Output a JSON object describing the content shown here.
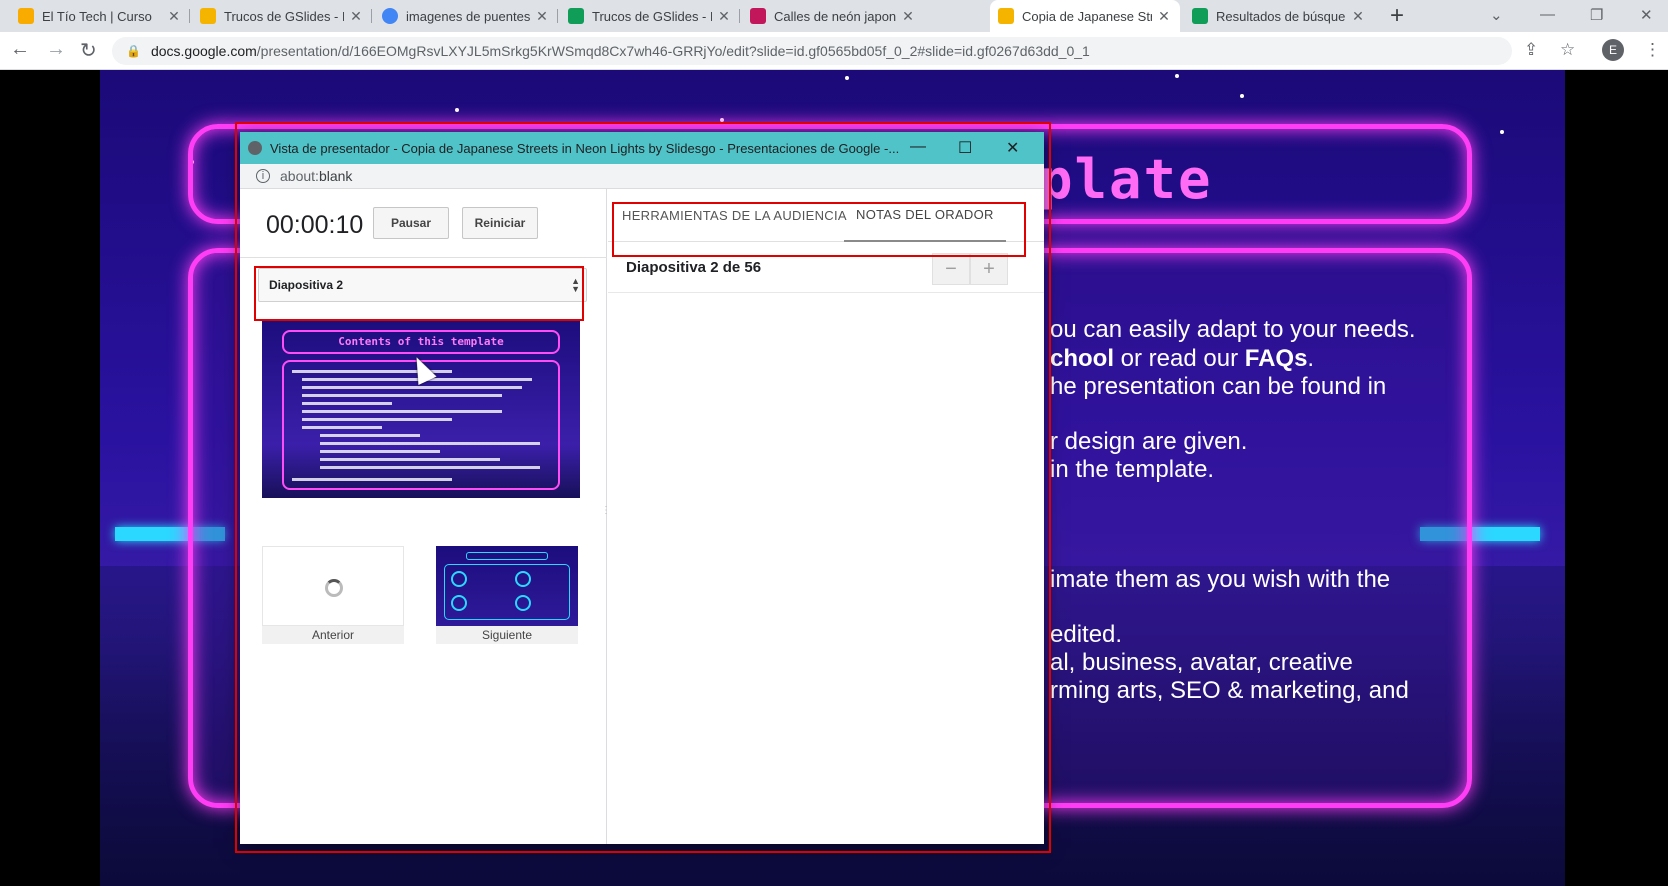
{
  "browser": {
    "tabs": [
      {
        "label": "El Tío Tech | Curso",
        "fav": "#f9ab00"
      },
      {
        "label": "Trucos de GSlides - Pr",
        "fav": "#f4b400"
      },
      {
        "label": "imagenes de puentes",
        "fav": "#4285f4"
      },
      {
        "label": "Trucos de GSlides - H",
        "fav": "#0f9d58"
      },
      {
        "label": "Calles de neón japone",
        "fav": "#c2185b"
      },
      {
        "label": "Copia de Japanese Str",
        "fav": "#f4b400"
      },
      {
        "label": "Resultados de búsque",
        "fav": "#0f9d58"
      }
    ],
    "url_host": "docs.google.com",
    "url_path": "/presentation/d/166EOMgRsvLXYJL5mSrkg5KrWSmqd8Cx7wh46-GRRjYo/edit?slide=id.gf0565bd05f_0_2#slide=id.gf0267d63dd_0_1",
    "profile_initial": "E"
  },
  "slide_bg": {
    "title_fragment": "plate",
    "lines": [
      {
        "text": "ou can easily adapt to your needs."
      },
      {
        "pre": "",
        "bold": "chool",
        "post": " or read our ",
        "bold2": "FAQs",
        "post2": "."
      },
      {
        "text": "he presentation can be found in"
      },
      {
        "text": "r design are given."
      },
      {
        "text": " in the template."
      },
      {
        "text": "imate them as you wish with the"
      },
      {
        "text": "edited."
      },
      {
        "text": "al, business, avatar, creative"
      },
      {
        "text": "rming arts, SEO & marketing, and"
      }
    ]
  },
  "presenter": {
    "window_title": "Vista de presentador - Copia de Japanese Streets in Neon Lights by Slidesgo - Presentaciones de Google -...",
    "url_scheme": "about:",
    "url_rest": "blank",
    "timer": "00:00:10",
    "pause_label": "Pausar",
    "restart_label": "Reiniciar",
    "slide_select": "Diapositiva 2",
    "thumb_title": "Contents of this template",
    "prev_label": "Anterior",
    "next_label": "Siguiente",
    "tab_audience": "HERRAMIENTAS DE LA AUDIENCIA",
    "tab_notes": "NOTAS DEL ORADOR",
    "slide_counter": "Diapositiva 2 de 56",
    "zoom_out": "−",
    "zoom_in": "+"
  },
  "colors": {
    "neon_pink": "#ff3df5",
    "neon_cyan": "#2bd8ff",
    "annotation_red": "#e00000",
    "titlebar": "#4fc3c7"
  }
}
